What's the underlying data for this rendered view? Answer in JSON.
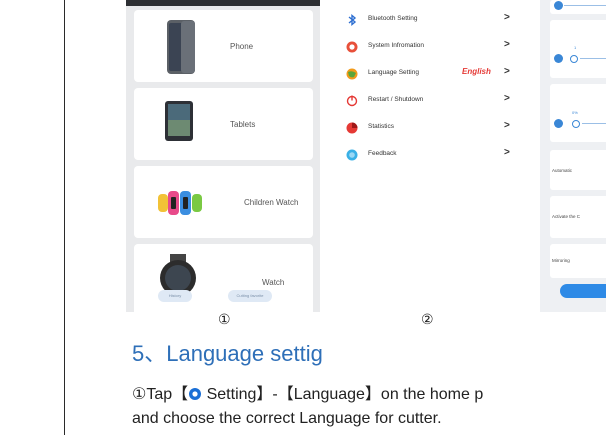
{
  "panel1": {
    "cards": [
      {
        "label": "Phone"
      },
      {
        "label": "Tablets"
      },
      {
        "label": "Children Watch"
      },
      {
        "label": "Watch"
      }
    ],
    "bottom_tabs": [
      "History",
      "Cutting favorite"
    ]
  },
  "panel2": {
    "rows": [
      {
        "label": "Bluetooth Setting",
        "icon": "bluetooth-icon",
        "color": "#2e6fd1"
      },
      {
        "label": "System Infromation",
        "icon": "info-icon",
        "color": "#e8503a"
      },
      {
        "label": "Language Setting",
        "icon": "language-icon",
        "color": "#f29a1a",
        "value": "English"
      },
      {
        "label": "Restart / Shutdown",
        "icon": "power-icon",
        "color": "#e53935"
      },
      {
        "label": "Statistics",
        "icon": "statistics-icon",
        "color": "#e53935"
      },
      {
        "label": "Feedback",
        "icon": "feedback-icon",
        "color": "#3ab0e6"
      }
    ]
  },
  "panel3": {
    "items": [
      "Automatic",
      "Activate the C",
      "Mirroring"
    ],
    "slider_labels": [
      "1",
      "0%"
    ]
  },
  "captions": {
    "step1": "①",
    "step2": "②"
  },
  "section": {
    "heading": "5、Language settig",
    "line1_prefix": "①Tap【",
    "line1_setting": " Setting】-【Language】on the home p",
    "line2": "and choose the correct Language for cutter."
  }
}
